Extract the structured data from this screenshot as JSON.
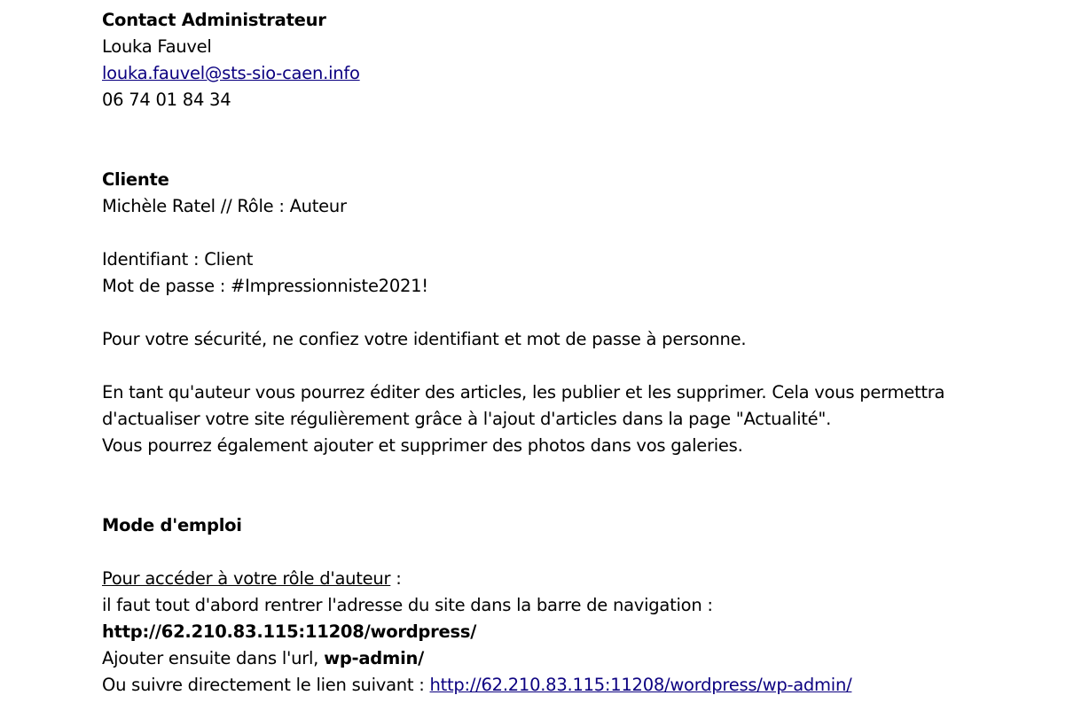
{
  "admin": {
    "heading": "Contact Administrateur",
    "name": "Louka Fauvel",
    "email": "louka.fauvel@sts-sio-caen.info",
    "phone": "06 74 01 84 34"
  },
  "client": {
    "heading": "Cliente",
    "name_role": "Michèle Ratel  // Rôle : Auteur",
    "identifier": "Identifiant : Client",
    "password": "Mot de passe : #Impressionniste2021!",
    "security_notice": "Pour votre sécurité, ne confiez votre identifiant et mot de passe  à personne.",
    "description_line1": "En tant qu'auteur vous pourrez éditer des articles, les publier et les supprimer. Cela vous permettra",
    "description_line2": "d'actualiser votre site régulièrement grâce à l'ajout d'articles dans la page \"Actualité\".",
    "description_line3": "Vous pourrez également ajouter et supprimer des photos dans vos galeries."
  },
  "manual": {
    "heading": "Mode d'emploi",
    "access_title": "Pour accéder à votre rôle d'auteur",
    "access_colon": " :",
    "step1": "il faut tout d'abord rentrer l'adresse du site dans la barre de navigation :",
    "site_url": "http://62.210.83.115:11208/wordpress/",
    "step2_prefix": "Ajouter ensuite dans l'url, ",
    "step2_bold": "wp-admin/",
    "step3_prefix": "Ou suivre directement le lien suivant : ",
    "admin_link": "http://62.210.83.115:11208/wordpress/wp-admin/"
  }
}
